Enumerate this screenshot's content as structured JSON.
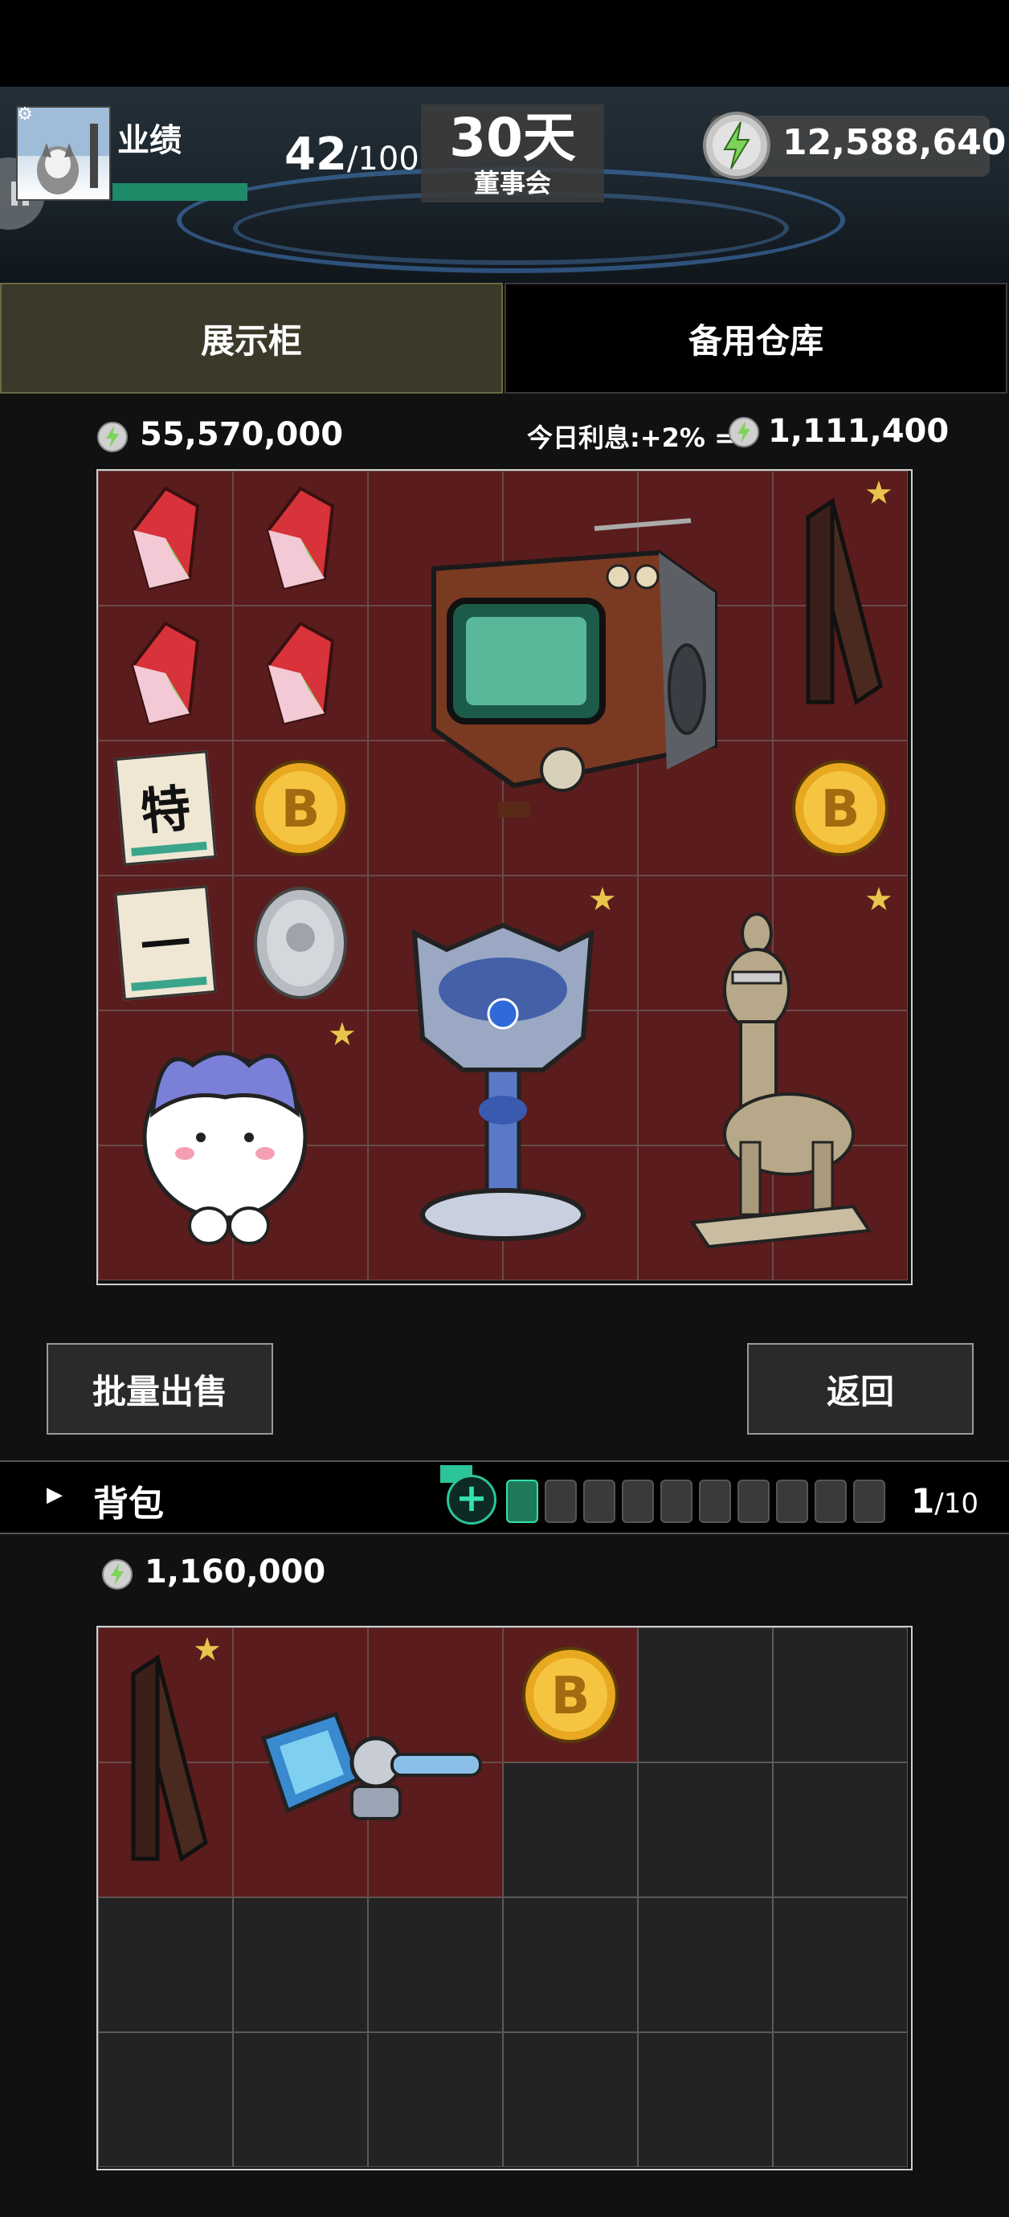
{
  "header": {
    "performance_label": "业绩",
    "performance_current": "42",
    "performance_max": "/100",
    "days_left": "30天",
    "days_caption": "董事会",
    "total_money": "12,588,640"
  },
  "tabs": [
    {
      "label": "展示柜",
      "active": true
    },
    {
      "label": "备用仓库",
      "active": false
    }
  ],
  "showcase": {
    "total_value": "55,570,000",
    "interest_label": "今日利息:+2% =",
    "interest_value": "1,111,400",
    "items": [
      {
        "name": "crystal-shard-1"
      },
      {
        "name": "crystal-shard-2"
      },
      {
        "name": "crystal-shard-3"
      },
      {
        "name": "crystal-shard-4"
      },
      {
        "name": "retro-tv",
        "starred": false
      },
      {
        "name": "wooden-plank",
        "starred": true
      },
      {
        "name": "lottery-ticket-special",
        "text": "特"
      },
      {
        "name": "gold-bitcoin-1"
      },
      {
        "name": "gold-bitcoin-2"
      },
      {
        "name": "lottery-ticket-first",
        "text": "一"
      },
      {
        "name": "silver-coin"
      },
      {
        "name": "trophy-cup",
        "starred": true
      },
      {
        "name": "alpaca-statue",
        "starred": true
      },
      {
        "name": "cat-plush",
        "starred": true
      }
    ]
  },
  "actions": {
    "bulk_sell": "批量出售",
    "back": "返回"
  },
  "backpack": {
    "label": "背包",
    "capacity_used": "1",
    "capacity_max": "/10",
    "plus": "+",
    "total_value": "1,160,000",
    "items": [
      {
        "name": "wooden-plank",
        "starred": true
      },
      {
        "name": "robot-arm"
      },
      {
        "name": "gold-bitcoin"
      }
    ]
  },
  "colors": {
    "slot_filled": "#5a1c1c",
    "slot_empty": "#232323",
    "accent_green": "#2cc49a",
    "star": "#e8c44c"
  }
}
